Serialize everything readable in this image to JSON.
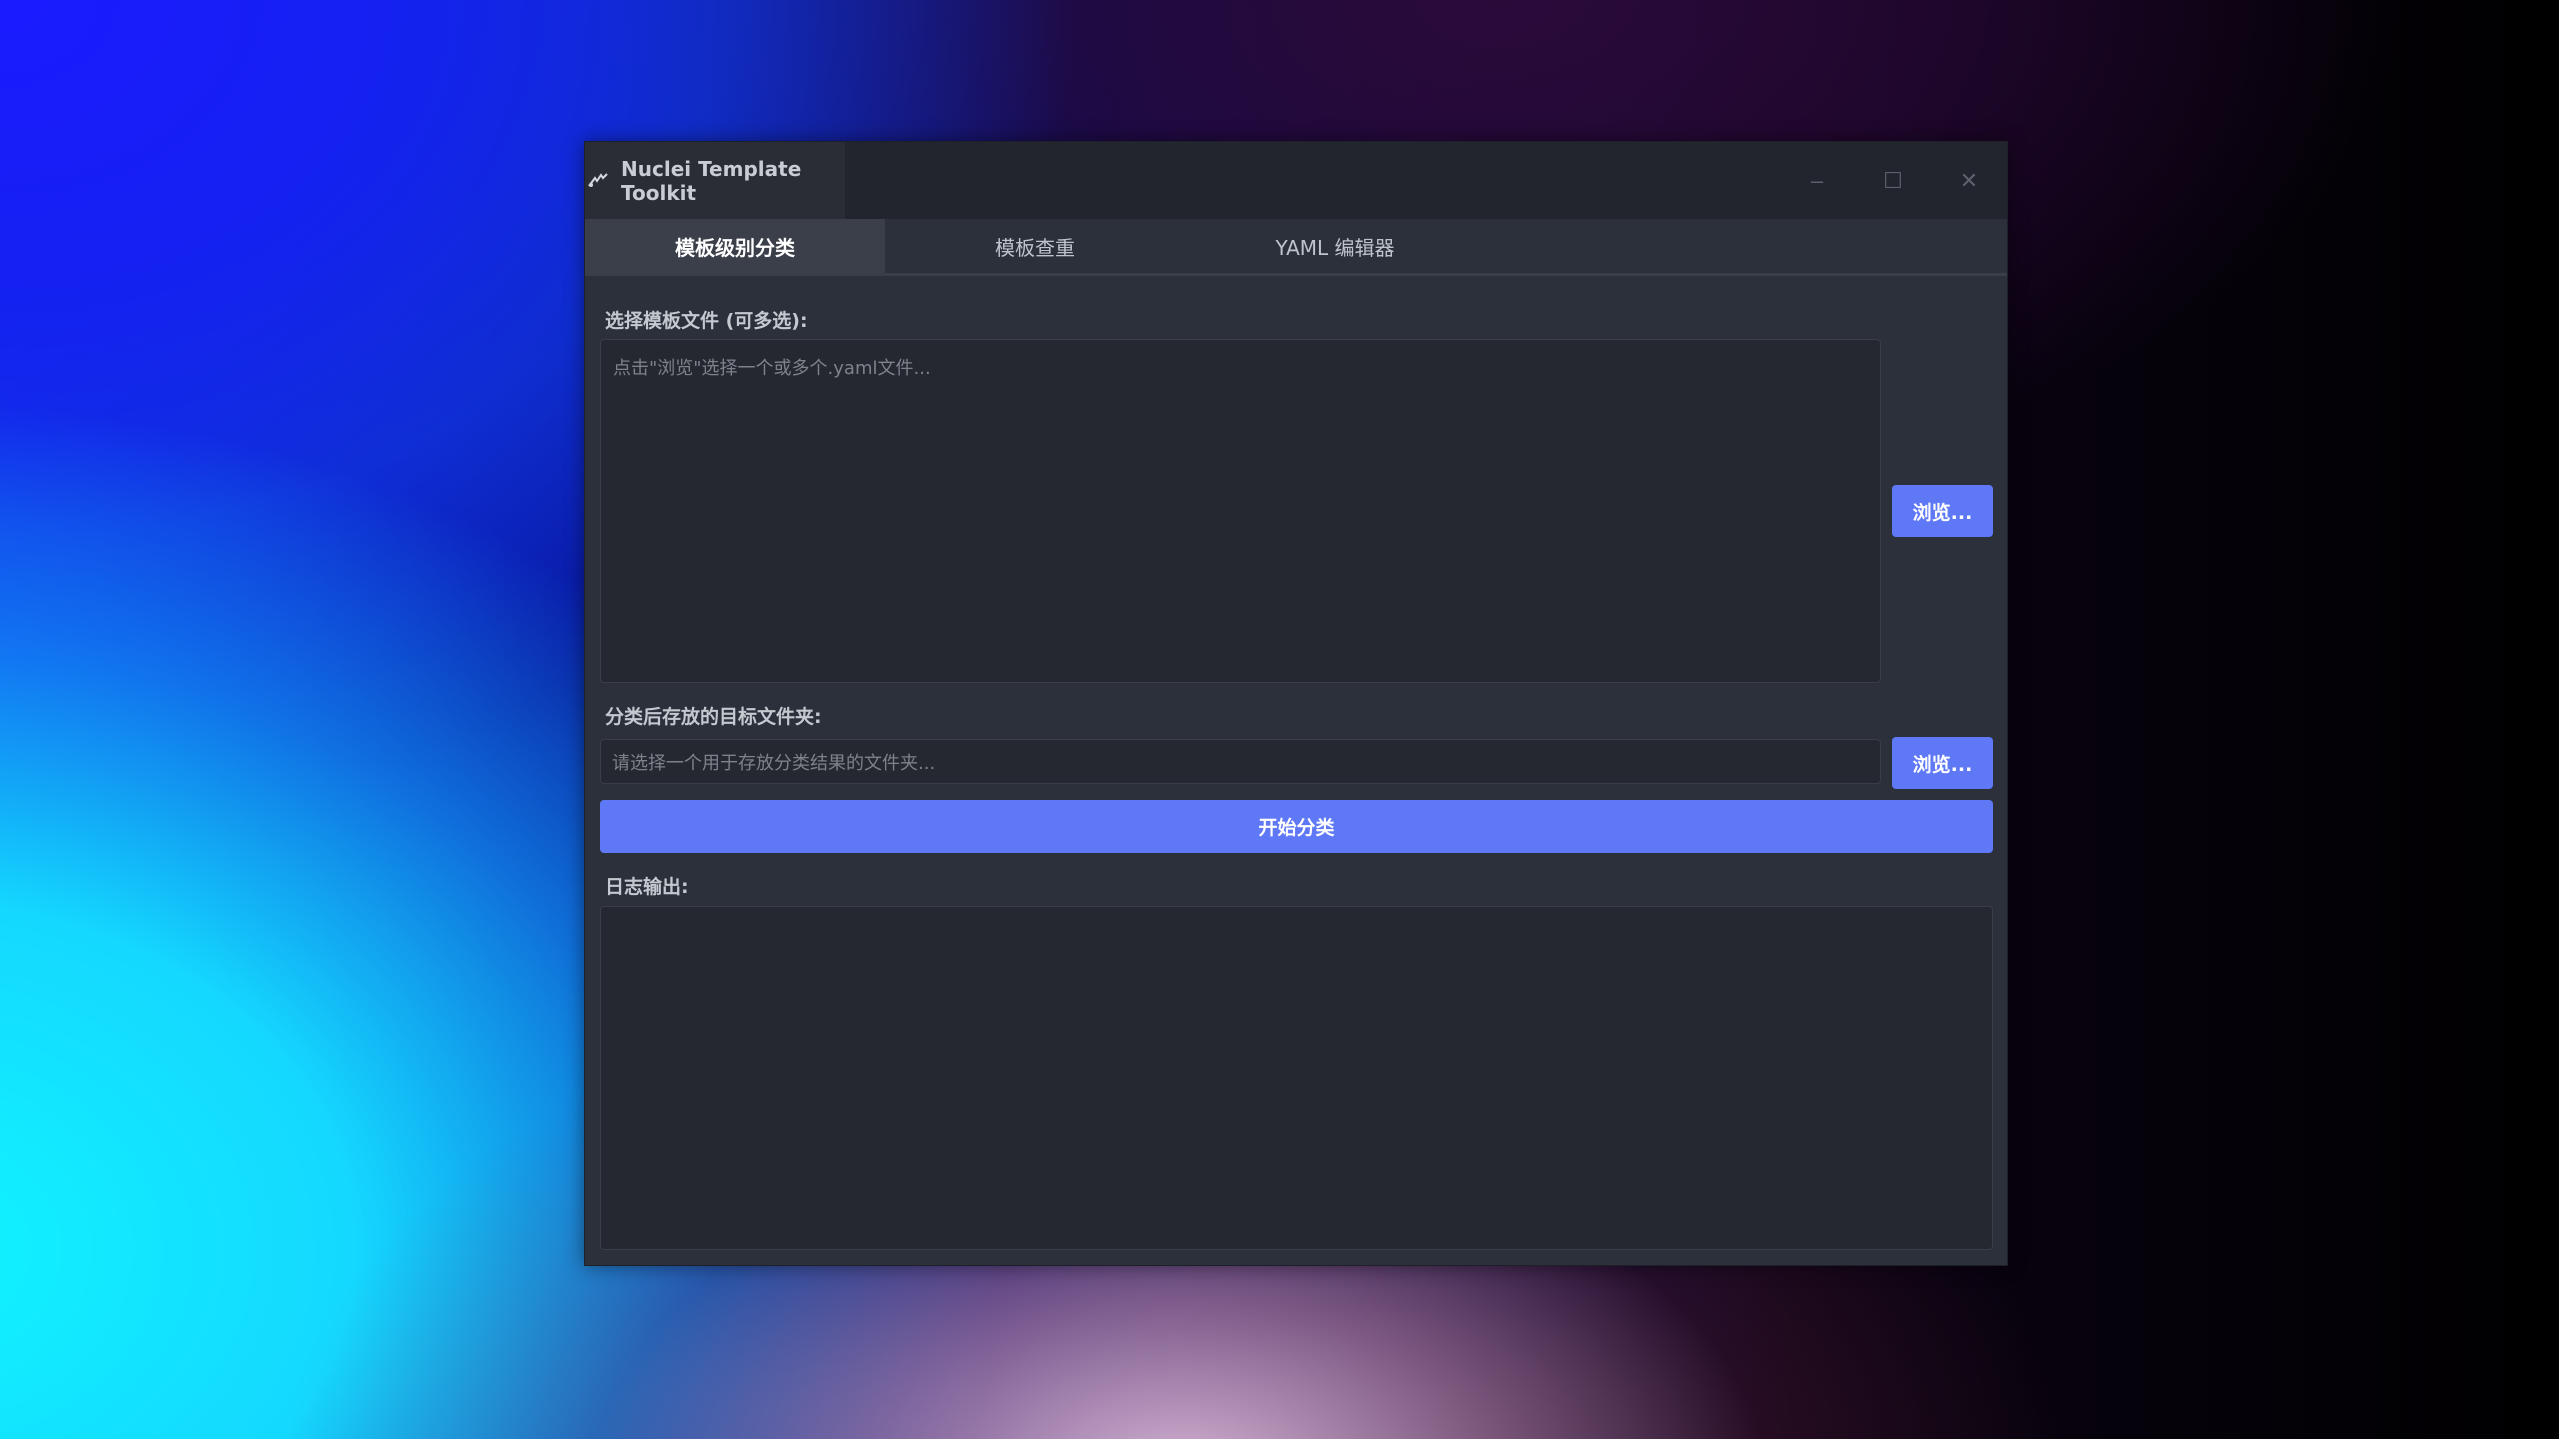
{
  "window": {
    "title": "Nuclei Template Toolkit",
    "controls": {
      "minimize": "–",
      "maximize": "☐",
      "close": "✕"
    }
  },
  "tabs": [
    {
      "label": "模板级别分类",
      "active": true
    },
    {
      "label": "模板查重",
      "active": false
    },
    {
      "label": "YAML 编辑器",
      "active": false
    }
  ],
  "classify": {
    "files_label": "选择模板文件 (可多选):",
    "files_placeholder": "点击\"浏览\"选择一个或多个.yaml文件...",
    "browse_files_label": "浏览...",
    "target_label": "分类后存放的目标文件夹:",
    "target_placeholder": "请选择一个用于存放分类结果的文件夹...",
    "browse_target_label": "浏览...",
    "start_label": "开始分类",
    "log_label": "日志输出:",
    "log_content": ""
  },
  "colors": {
    "accent": "#5f78f6",
    "window_bg": "#2c303b",
    "field_bg": "#252830"
  },
  "icons": {
    "app": "nuclei-icon"
  }
}
